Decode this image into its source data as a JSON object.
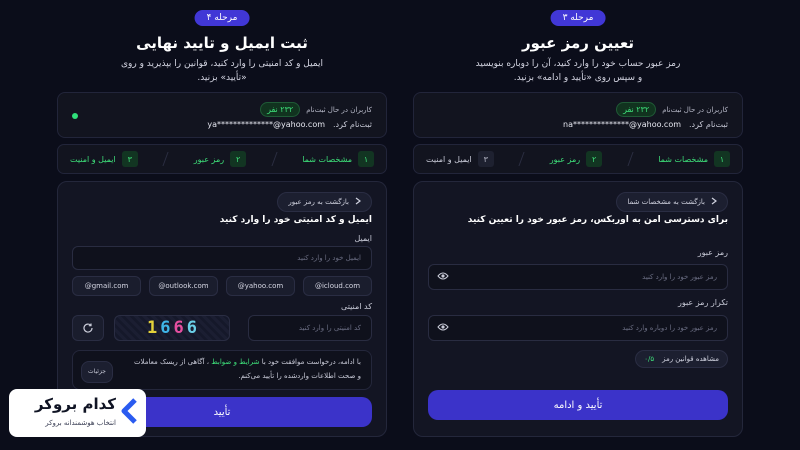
{
  "panel_left": {
    "step_badge": "مرحله ۴",
    "title": "ثبت ایمیل و تایید نهایی",
    "desc": "ایمیل و کد امنیتی را وارد کنید، قوانین را بپذیرید و روی «تأیید» بزنید.",
    "user_card": {
      "registering_label": "کاربران در حال ثبت‌نام",
      "count_badge": "۲۳۲ نفر",
      "email": "ya**************@yahoo.com",
      "status": "ثبت‌نام کرد."
    },
    "steps": [
      {
        "num": "۱",
        "label": "مشخصات شما"
      },
      {
        "num": "۲",
        "label": "رمز عبور"
      },
      {
        "num": "۳",
        "label": "ایمیل و امنیت"
      }
    ],
    "back_label": "بازگشت به رمز عبور",
    "heading": "ایمیل و کد امنیتی خود را وارد کنید",
    "email_label": "ایمیل",
    "email_placeholder": "ایمیل خود را وارد کنید",
    "domains": [
      "@gmail.com",
      "@outlook.com",
      "@yahoo.com",
      "@icloud.com"
    ],
    "captcha_label": "کد امنیتی",
    "captcha_chars": [
      "1",
      "6",
      "6",
      "6"
    ],
    "captcha_colors": [
      "#e4d23a",
      "#3fb5e8",
      "#e54fa0",
      "#6ad0e8"
    ],
    "captcha_placeholder": "کد امنیتی را وارد کنید",
    "terms_prefix": "با ادامه، درخواست موافقت خود با",
    "terms_link": "شرایط و ضوابط",
    "terms_suffix": "، آگاهی از ریسک معاملات و صحت اطلاعات واردشده را تأیید می‌کنم.",
    "details_label": "جزئیات",
    "submit_label": "تأیید"
  },
  "panel_right": {
    "step_badge": "مرحله ۳",
    "title": "تعیین رمز عبور",
    "desc": "رمز عبور حساب خود را وارد کنید، آن را دوباره بنویسید و سپس روی «تأیید و ادامه» بزنید.",
    "user_card": {
      "registering_label": "کاربران در حال ثبت‌نام",
      "count_badge": "۲۳۲ نفر",
      "email": "na**************@yahoo.com",
      "status": "ثبت‌نام کرد."
    },
    "steps": [
      {
        "num": "۱",
        "label": "مشخصات شما"
      },
      {
        "num": "۲",
        "label": "رمز عبور"
      },
      {
        "num": "۳",
        "label": "ایمیل و امنیت"
      }
    ],
    "back_label": "بازگشت به مشخصات شما",
    "heading": "برای دسترسی امن به اوربکس، رمز عبور خود را تعیین کنید",
    "password_label": "رمز عبور",
    "password_placeholder": "رمز عبور خود را وارد کنید",
    "repeat_label": "تکرار رمز عبور",
    "repeat_placeholder": "رمز عبور خود را دوباره وارد کنید",
    "rules_label": "مشاهده قوانین رمز",
    "rules_ratio": "۰/۵",
    "submit_label": "تأیید و ادامه"
  },
  "logo": {
    "name": "کدام بروکر",
    "tagline": "انتخاب هوشمندانه بروکر"
  },
  "colors": {
    "accent": "#3b33c9",
    "success": "#3ee07a",
    "background": "#0b0d1a"
  }
}
